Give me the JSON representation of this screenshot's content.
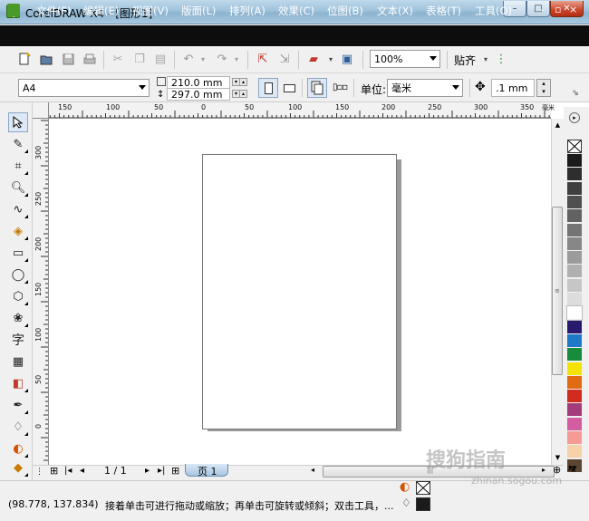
{
  "window": {
    "title": "CorelDRAW X4 - [图形1]",
    "min": "–",
    "max": "□",
    "close": "✕"
  },
  "menu": {
    "items": [
      "文件(F)",
      "编辑(E)",
      "视图(V)",
      "版面(L)",
      "排列(A)",
      "效果(C)",
      "位图(B)",
      "文本(X)",
      "表格(T)",
      "工具(O)"
    ],
    "mdi": [
      "–",
      "▫",
      "×"
    ]
  },
  "toolbar1": {
    "zoom": "100%",
    "snap": "贴齐"
  },
  "toolbar2": {
    "paper": "A4",
    "width": "210.0 mm",
    "height": "297.0 mm",
    "units_label": "单位:",
    "units": "毫米",
    "nudge": ".1 mm"
  },
  "ruler": {
    "h_labels": [
      "150",
      "100",
      "50",
      "0",
      "50",
      "100",
      "150",
      "200",
      "250",
      "300",
      "350",
      "毫米"
    ],
    "v_labels": [
      "300",
      "250",
      "200",
      "150",
      "100",
      "50",
      "0"
    ]
  },
  "toolbox": {
    "text_tool": "字"
  },
  "palette": {
    "colors": [
      "#1b1b1b",
      "#2e2e2e",
      "#3f3f3f",
      "#505050",
      "#626262",
      "#747474",
      "#878787",
      "#9b9b9b",
      "#b0b0b0",
      "#c6c6c6",
      "#dcdcdc",
      "#ffffff",
      "#2a1a6e",
      "#1f79c8",
      "#168c3c",
      "#f5e200",
      "#e06b12",
      "#d22b1f",
      "#a43c7b",
      "#d25da0",
      "#f59a95",
      "#f7d1a8",
      "#5a4632"
    ]
  },
  "pagebar": {
    "page_count": "1 / 1",
    "page_tab": "页 1"
  },
  "status": {
    "coords": "(98.778, 137.834)",
    "hint": "接着单击可进行拖动或缩放；再单击可旋转或倾斜；双击工具，..."
  },
  "watermark": {
    "text": "搜狗指南",
    "url": "zhinan.sogou.com"
  }
}
